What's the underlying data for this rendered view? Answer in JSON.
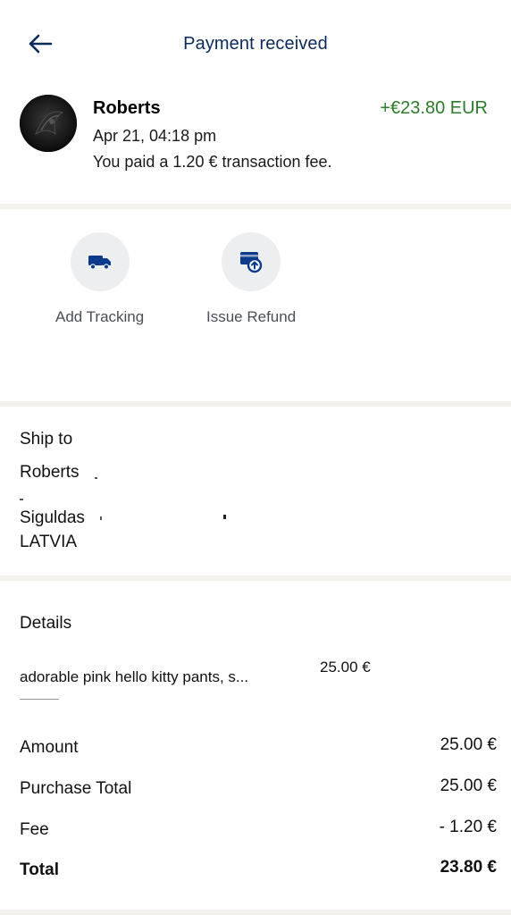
{
  "header": {
    "title": "Payment received",
    "back_icon": "arrow-left-icon"
  },
  "transaction": {
    "payer_name": "Roberts",
    "amount": "+€23.80 EUR",
    "date": "Apr 21, 04:18 pm",
    "fee_note": "You paid a 1.20 € transaction fee.",
    "amount_color": "#2a7d2a"
  },
  "actions": [
    {
      "label": "Add Tracking",
      "icon": "truck-icon"
    },
    {
      "label": "Issue Refund",
      "icon": "refund-icon"
    }
  ],
  "ship_to": {
    "heading": "Ship to",
    "name": "Roberts",
    "city": "Siguldas",
    "country": "LATVIA"
  },
  "details": {
    "heading": "Details",
    "item_description": "adorable pink hello kitty pants, s...",
    "item_price": "25.00 €",
    "rows": [
      {
        "label": "Amount",
        "value": "25.00 €"
      },
      {
        "label": "Purchase Total",
        "value": "25.00 €"
      },
      {
        "label": "Fee",
        "value": "- 1.20 €"
      },
      {
        "label": "Total",
        "value": "23.80 €"
      }
    ]
  },
  "colors": {
    "title": "#0b2a5b",
    "icon_blue": "#0b3a8c",
    "action_bg": "#eceeef",
    "divider": "#f4f2ef"
  }
}
